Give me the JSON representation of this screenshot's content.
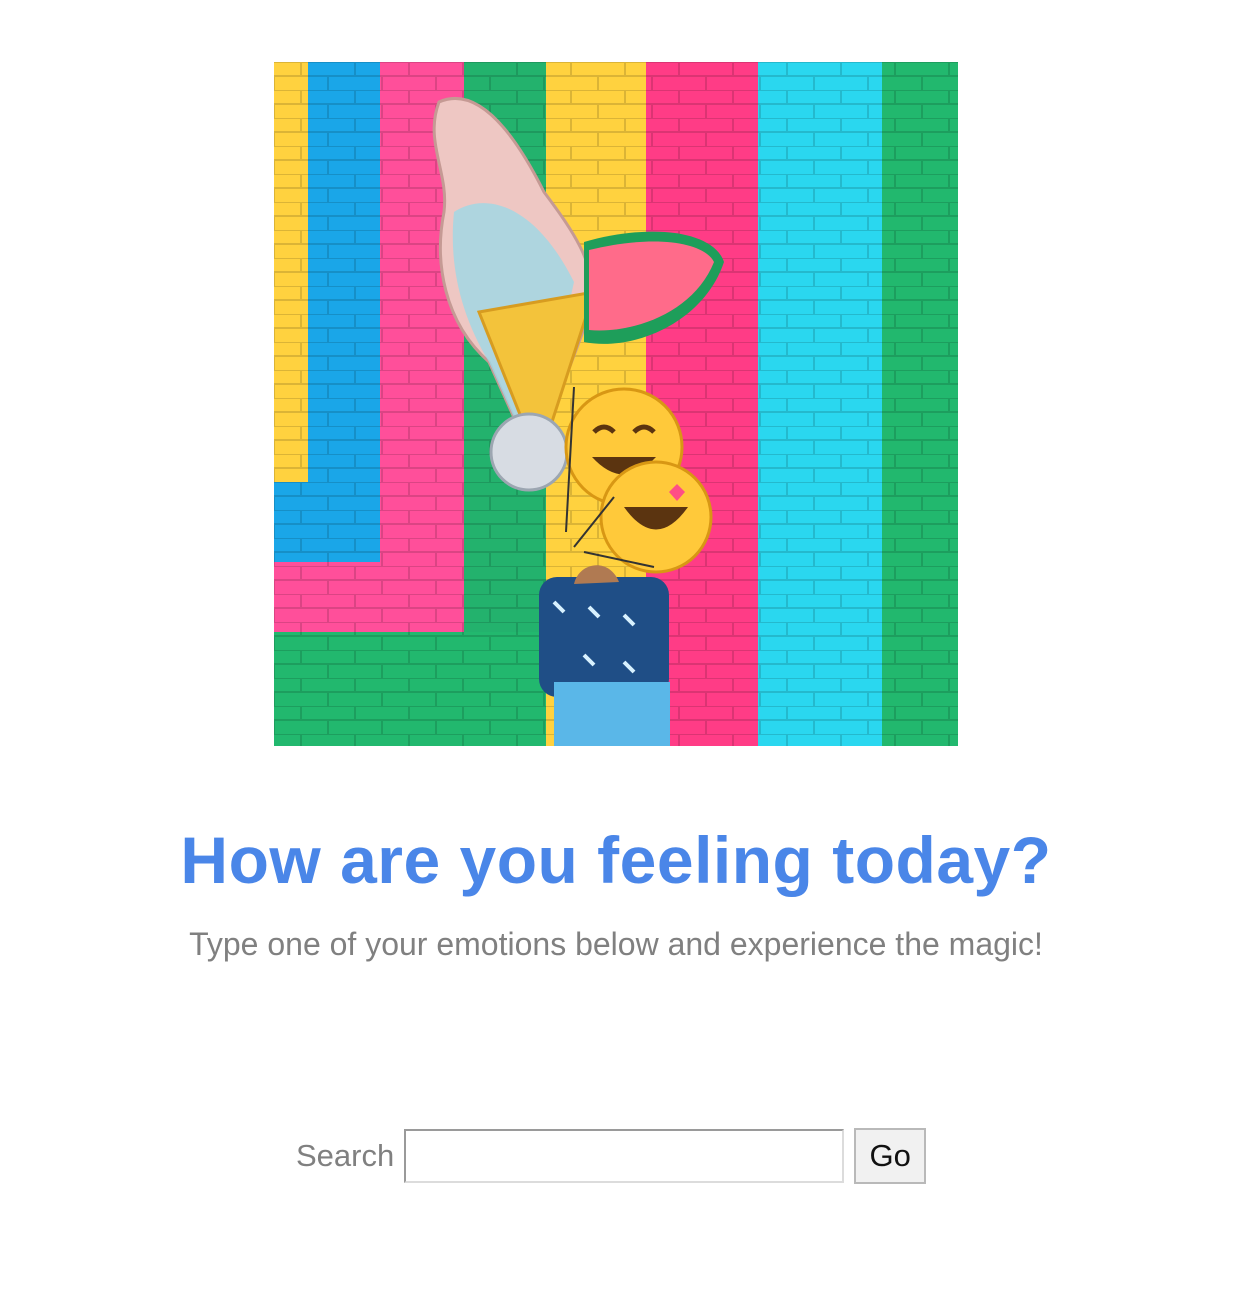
{
  "hero": {
    "image_name": "colorful-brick-wall-with-balloons"
  },
  "heading": {
    "title": "How are you feeling today?",
    "subtitle": "Type one of your emotions below and experience the magic!"
  },
  "search": {
    "label": "Search",
    "value": "",
    "placeholder": "",
    "button_label": "Go"
  },
  "colors": {
    "title": "#4a86e8",
    "subtitle": "#808080"
  }
}
